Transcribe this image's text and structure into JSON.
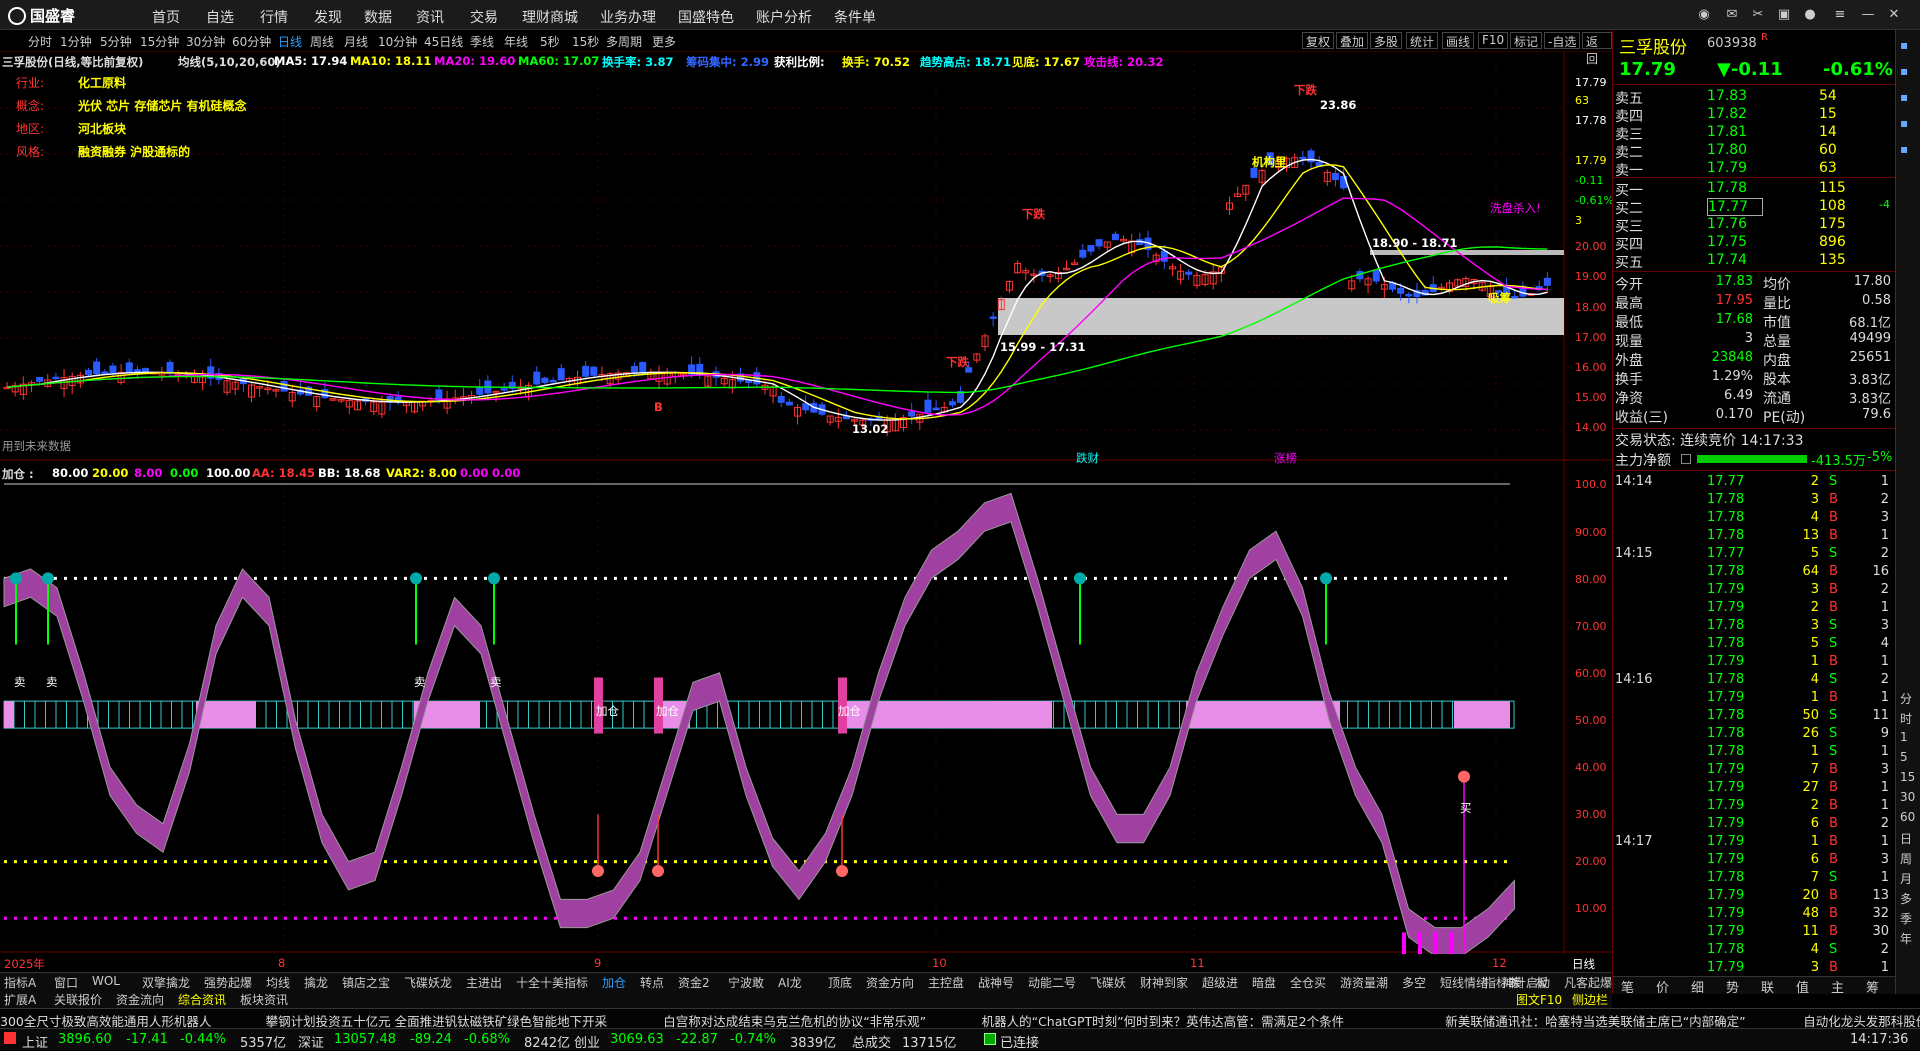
{
  "menubar": {
    "logo": "国盛睿",
    "items": [
      "首页",
      "自选",
      "行情",
      "发现",
      "数据",
      "资讯",
      "交易",
      "理财商城",
      "业务办理",
      "国盛特色",
      "账户分析",
      "条件单"
    ]
  },
  "toolbar": {
    "periods": [
      "分时",
      "1分钟",
      "5分钟",
      "15分钟",
      "30分钟",
      "60分钟",
      "日线",
      "周线",
      "月线",
      "10分钟",
      "45日线",
      "季线",
      "年线",
      "5秒",
      "15秒",
      "多周期",
      "更多"
    ],
    "active": "日线",
    "right": [
      "复权",
      "叠加",
      "多股",
      "统计",
      "画线",
      "F10",
      "标记",
      "-自选",
      "返回"
    ]
  },
  "legend": {
    "title": "三孚股份(日线,等比前复权)",
    "ma_label": "均线(5,10,20,60)",
    "ma5": "MA5: 17.94",
    "ma10": "MA10: 18.11",
    "ma20": "MA20: 19.60",
    "ma60": "MA60: 17.07",
    "turn": "换手率: 3.87",
    "chip": "筹码集中: 2.99",
    "profit_label": "获利比例:",
    "hand": "换手: 70.52",
    "trend": "趋势高点: 18.71",
    "low": "见底: 17.67",
    "attack": "攻击线: 20.32"
  },
  "info": [
    {
      "k": "行业:",
      "v": "化工原料"
    },
    {
      "k": "概念:",
      "v": "光伏 芯片 存储芯片 有机硅概念"
    },
    {
      "k": "地区:",
      "v": "河北板块"
    },
    {
      "k": "风格:",
      "v": "融资融券 沪股通标的"
    }
  ],
  "main_annotations": {
    "high": "23.86",
    "low": "13.02",
    "box1": "15.99 - 17.31",
    "box2": "18.90 - 18.71",
    "future": "用到未来数据",
    "sell": "下跌",
    "xipan": "洗盘杀入!",
    "tiecai": "跌财",
    "zhangbang": "涨榜",
    "jigou": "机构里",
    "xigu": "吸筹",
    "b": "B"
  },
  "price_axis": [
    "17.79",
    "63",
    "17.78",
    "17.79",
    "-0.11",
    "-0.61%",
    "3",
    "20.00",
    "19.00",
    "18.00",
    "17.00",
    "16.00",
    "15.00",
    "14.00"
  ],
  "sub_legend": {
    "name": "加仓",
    "v1": "80.00",
    "v2": "20.00",
    "v3": "8.00",
    "v4": "0.00",
    "v5": "100.00",
    "aa": "AA: 18.45",
    "bb": "BB: 18.68",
    "var2": "VAR2: 8.00",
    "v6": "0.00",
    "v7": "0.00"
  },
  "sub_axis": [
    "100.0",
    "90.00",
    "80.00",
    "70.00",
    "60.00",
    "50.00",
    "40.00",
    "30.00",
    "20.00",
    "10.00"
  ],
  "sub_labels": {
    "sell": "卖",
    "add": "加仓",
    "buy": "买"
  },
  "date_axis": {
    "year": "2025年",
    "m8": "8",
    "m9": "9",
    "m10": "10",
    "m11": "11",
    "m12": "12",
    "mode": "日线"
  },
  "bottom_tabs_1": [
    "指标A",
    "窗口",
    "WOL",
    "双擎擒龙",
    "强势起爆",
    "均线",
    "擒龙",
    "镇店之宝",
    "飞碟妖龙",
    "主进出",
    "十全十美指标",
    "加仓",
    "转点",
    "资金2",
    "宁波敢",
    "AI龙",
    "顶底",
    "资金方向",
    "主控盘",
    "战神号",
    "动能二号",
    "飞碟妖",
    "财神到家",
    "超级进",
    "暗盘",
    "全仓买",
    "游资量潮",
    "多空",
    "短线情绪",
    "神针启动",
    "凡客起爆",
    "波段王"
  ],
  "bottom_tabs_1_right": [
    "指标B",
    "模",
    "板"
  ],
  "bottom_tabs_2": [
    "扩展A",
    "关联报价",
    "资金流向",
    "综合资讯",
    "板块资讯"
  ],
  "bottom_tabs_2_right": [
    "图文F10",
    "侧边栏"
  ],
  "side": {
    "name": "三孚股份",
    "code": "603938",
    "r": "R",
    "price": "17.79",
    "chg": "▼-0.11",
    "pct": "-0.61%",
    "asks": [
      {
        "l": "卖五",
        "p": "17.83",
        "v": "54"
      },
      {
        "l": "卖四",
        "p": "17.82",
        "v": "15"
      },
      {
        "l": "卖三",
        "p": "17.81",
        "v": "14"
      },
      {
        "l": "卖二",
        "p": "17.80",
        "v": "60"
      },
      {
        "l": "卖一",
        "p": "17.79",
        "v": "63"
      }
    ],
    "bids": [
      {
        "l": "买一",
        "p": "17.78",
        "v": "115"
      },
      {
        "l": "买二",
        "p": "17.77",
        "v": "108",
        "d": "-4"
      },
      {
        "l": "买三",
        "p": "17.76",
        "v": "175"
      },
      {
        "l": "买四",
        "p": "17.75",
        "v": "896"
      },
      {
        "l": "买五",
        "p": "17.74",
        "v": "135"
      }
    ],
    "stats": [
      [
        "今开",
        "17.83",
        "均价",
        "17.80"
      ],
      [
        "最高",
        "17.95",
        "量比",
        "0.58"
      ],
      [
        "最低",
        "17.68",
        "市值",
        "68.1亿"
      ],
      [
        "现量",
        "3",
        "总量",
        "49499"
      ],
      [
        "外盘",
        "23848",
        "内盘",
        "25651"
      ],
      [
        "换手",
        "1.29%",
        "股本",
        "3.83亿"
      ],
      [
        "净资",
        "6.49",
        "流通",
        "3.83亿"
      ],
      [
        "收益(三)",
        "0.170",
        "PE(动)",
        "79.6"
      ]
    ],
    "trade_state": "交易状态: 连续竞价 14:17:33",
    "main_net": "主力净额",
    "main_val": "-413.5万",
    "main_pct": "-5%",
    "ticks": [
      [
        "14:14",
        "17.77",
        "2",
        "S",
        "1"
      ],
      [
        "",
        "17.78",
        "3",
        "B",
        "2"
      ],
      [
        "",
        "17.78",
        "4",
        "B",
        "3"
      ],
      [
        "",
        "17.78",
        "13",
        "B",
        "1"
      ],
      [
        "14:15",
        "17.77",
        "5",
        "S",
        "2"
      ],
      [
        "",
        "17.78",
        "64",
        "B",
        "16"
      ],
      [
        "",
        "17.79",
        "3",
        "B",
        "2"
      ],
      [
        "",
        "17.79",
        "2",
        "B",
        "1"
      ],
      [
        "",
        "17.78",
        "3",
        "S",
        "3"
      ],
      [
        "",
        "17.78",
        "5",
        "S",
        "4"
      ],
      [
        "",
        "17.79",
        "1",
        "B",
        "1"
      ],
      [
        "14:16",
        "17.78",
        "4",
        "S",
        "2"
      ],
      [
        "",
        "17.79",
        "1",
        "B",
        "1"
      ],
      [
        "",
        "17.78",
        "50",
        "S",
        "11"
      ],
      [
        "",
        "17.78",
        "26",
        "S",
        "9"
      ],
      [
        "",
        "17.78",
        "1",
        "S",
        "1"
      ],
      [
        "",
        "17.79",
        "7",
        "B",
        "3"
      ],
      [
        "",
        "17.79",
        "27",
        "B",
        "1"
      ],
      [
        "",
        "17.79",
        "2",
        "B",
        "1"
      ],
      [
        "",
        "17.79",
        "6",
        "B",
        "2"
      ],
      [
        "14:17",
        "17.79",
        "1",
        "B",
        "1"
      ],
      [
        "",
        "17.79",
        "6",
        "B",
        "3"
      ],
      [
        "",
        "17.78",
        "7",
        "S",
        "1"
      ],
      [
        "",
        "17.79",
        "20",
        "B",
        "13"
      ],
      [
        "",
        "17.79",
        "48",
        "B",
        "32"
      ],
      [
        "",
        "17.79",
        "11",
        "B",
        "30"
      ],
      [
        "",
        "17.78",
        "4",
        "S",
        "2"
      ],
      [
        "",
        "17.79",
        "3",
        "B",
        "1"
      ]
    ],
    "bottom": [
      "笔",
      "价",
      "细",
      "势",
      "联",
      "值",
      "主",
      "筹"
    ]
  },
  "vtabs": [
    "分",
    "时",
    "1",
    "5",
    "15",
    "30",
    "60",
    "日",
    "周",
    "月",
    "多",
    "季",
    "年"
  ],
  "news": [
    "300全尺寸极致高效能通用人形机器人",
    "攀钢计划投资五十亿元 全面推进钒钛磁铁矿绿色智能地下开采",
    "白宫称对达成结束乌克兰危机的协议“非常乐观”",
    "机器人的“ChatGPT时刻”何时到来？英伟达高管：需满足2个条件",
    "新美联储通讯社：哈塞特当选美联储主席已“内部确定”",
    "自动化龙头发那科股价大涨近10%！强强联手英伟"
  ],
  "status": {
    "sh_l": "上证",
    "sh_v": "3896.60",
    "sh_c": "-17.41",
    "sh_p": "-0.44%",
    "sh_a": "5357亿",
    "sz_l": "深证",
    "sz_v": "13057.48",
    "sz_c": "-89.24",
    "sz_p": "-0.68%",
    "sz_a": "8242亿",
    "cy_l": "创业",
    "cy_v": "3069.63",
    "cy_c": "-22.87",
    "cy_p": "-0.74%",
    "cy_a": "3839亿",
    "total_l": "总成交",
    "total_v": "13715亿",
    "conn": "已连接",
    "time": "14:17:36"
  },
  "colors": {
    "up": "#ff3333",
    "down": "#2a5bff",
    "ma5": "#ffffff",
    "ma10": "#ffff00",
    "ma20": "#ff00ff",
    "ma60": "#00ff00"
  }
}
